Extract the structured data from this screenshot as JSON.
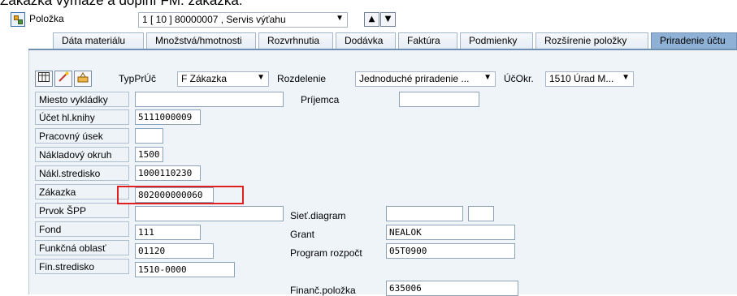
{
  "caption": "Zákazka vymaže a doplní FM. zákazka.",
  "item": {
    "label": "Položka",
    "value": "1 [ 10 ] 80000007 , Servis výťahu"
  },
  "tabs": [
    "Dáta materiálu",
    "Množstvá/hmotnosti",
    "Rozvrhnutia",
    "Dodávka",
    "Faktúra",
    "Podmienky",
    "Rozšírenie položky",
    "Priradenie účtu"
  ],
  "toolbar": {
    "typpruc_label": "TypPrÚč",
    "typpruc_value": "F Zákazka",
    "rozdelenie_label": "Rozdelenie",
    "rozdelenie_value": "Jednoduché priradenie ...",
    "ucokr_label": "ÚčOkr.",
    "ucokr_value": "1510 Úrad M..."
  },
  "fields": {
    "miesto_vykladky": {
      "label": "Miesto vykládky",
      "value": ""
    },
    "prijemca": {
      "label": "Príjemca",
      "value": ""
    },
    "ucet": {
      "label": "Účet hl.knihy",
      "value": "5111000009"
    },
    "pracovny_usek": {
      "label": "Pracovný úsek",
      "value": ""
    },
    "nakladovy_okruh": {
      "label": "Nákladový okruh",
      "value": "1500"
    },
    "nakl_stredisko": {
      "label": "Nákl.stredisko",
      "value": "1000110230"
    },
    "zakazka": {
      "label": "Zákazka",
      "value": "802000000060"
    },
    "prvok_spp": {
      "label": "Prvok ŠPP",
      "value": ""
    },
    "siet_diagram": {
      "label": "Sieť.diagram",
      "value": ""
    },
    "fond": {
      "label": "Fond",
      "value": "111"
    },
    "grant": {
      "label": "Grant",
      "value": "NEALOK"
    },
    "funkcna_oblast": {
      "label": "Funkčná oblasť",
      "value": "01120"
    },
    "program_rozpoct": {
      "label": "Program rozpočt",
      "value": "05T0900"
    },
    "fin_stredisko": {
      "label": "Fin.stredisko",
      "value": "1510-0000"
    },
    "financ_polozka": {
      "label": "Finanč.položka",
      "value": "635006"
    }
  },
  "colors": {
    "active_tab": "#8fb1d5",
    "highlight": "#e02020",
    "panel": "#eff4f9"
  }
}
